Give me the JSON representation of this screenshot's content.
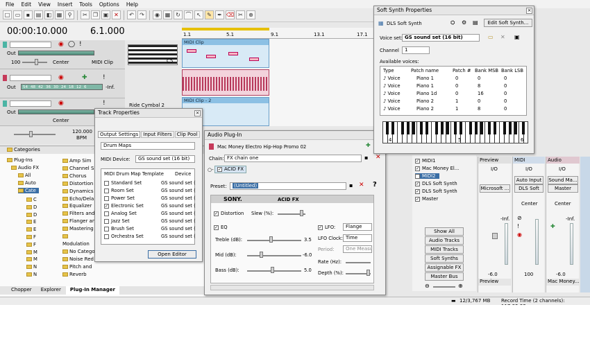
{
  "menu": [
    "File",
    "Edit",
    "View",
    "Insert",
    "Tools",
    "Options",
    "Help"
  ],
  "transport": {
    "time": "00:00:10.000",
    "measure": "6.1.000",
    "tempo": "120.000",
    "tempo_label": "BPM"
  },
  "ruler_marks": [
    "1.1",
    "5.1",
    "9.1",
    "13.1",
    "17.1",
    "21.1"
  ],
  "tracks": [
    {
      "out": "Out",
      "vol": "100",
      "pan": "Center",
      "clip": "MIDI Clip",
      "note_label": "C5"
    },
    {
      "out": "Out",
      "pan": "Center",
      "clip": "-Inf.",
      "meter": [
        "54",
        "48",
        "42",
        "36",
        "30",
        "24",
        "18",
        "12",
        "6"
      ]
    },
    {
      "out": "Out",
      "pan": "Center",
      "clip": "MIDI Clip",
      "label": "Ride Cymbal 2"
    }
  ],
  "clips": {
    "midi1": "MIDI Clip",
    "midi2": "MIDI Clip - 2"
  },
  "plugin_browser": {
    "categories_label": "Categories",
    "tree": [
      "Plug-Ins",
      "Audio FX",
      "All",
      "Auto",
      "Cate"
    ],
    "items": [
      "Amp Sim",
      "Channel S",
      "Chorus",
      "Distortion",
      "Dynamics",
      "Echo/Dela",
      "Equalizer",
      "Filters and",
      "Flanger an",
      "Mastering",
      "Modulation",
      "No Catego",
      "Noise Red",
      "Pitch and",
      "Reverb"
    ],
    "tabs": [
      "Chopper",
      "Explorer",
      "Plug-In Manager"
    ]
  },
  "track_properties": {
    "title": "Track Properties",
    "tabs": [
      "Output Settings",
      "Input Filters",
      "Clip Pool"
    ],
    "drum_maps": "Drum Maps",
    "midi_device_label": "MIDI Device:",
    "midi_device": "GS sound set (16 bit)",
    "col_template": "MIDI Drum Map Template",
    "col_device": "Device",
    "rows": [
      {
        "name": "Standard Set",
        "device": "GS sound set (",
        "checked": false
      },
      {
        "name": "Room Set",
        "device": "GS sound set (",
        "checked": false
      },
      {
        "name": "Power Set",
        "device": "GS sound set (",
        "checked": false
      },
      {
        "name": "Electronic Set",
        "device": "GS sound set (",
        "checked": true
      },
      {
        "name": "Analog Set",
        "device": "GS sound set (",
        "checked": false
      },
      {
        "name": "Jazz Set",
        "device": "GS sound set (",
        "checked": false
      },
      {
        "name": "Brush Set",
        "device": "GS sound set (",
        "checked": false
      },
      {
        "name": "Orchestra Set",
        "device": "GS sound set (",
        "checked": false
      }
    ],
    "open_editor": "Open Editor"
  },
  "audio_plugin": {
    "title": "Audio Plug-In",
    "track_name": "Mac Money Electro Hip-Hop Promo 02",
    "chain_label": "Chain:",
    "chain_value": "FX chain one",
    "fx_tab": "ACID FX",
    "preset_label": "Preset:",
    "preset_value": "(Untitled)",
    "brand": "SONY.",
    "product": "ACID FX",
    "distortion_label": "Distortion",
    "slew_label": "Slew (%):",
    "eq_label": "EQ",
    "treble_label": "Treble (dB):",
    "treble_value": "3.5",
    "mid_label": "Mid (dB):",
    "mid_value": "-6.0",
    "bass_label": "Bass (dB):",
    "bass_value": "5.0",
    "lfo_label": "LFO:",
    "lfo_value": "Flange",
    "lfo_clock_label": "LFO Clock:",
    "lfo_clock_value": "Time",
    "period_label": "Period:",
    "period_value": "One Measure",
    "rate_label": "Rate (Hz):",
    "depth_label": "Depth (%):"
  },
  "soft_synth": {
    "title": "Soft Synth Properties",
    "synth_name": "DLS Soft Synth",
    "edit_label": "Edit Soft Synth...",
    "voice_set_label": "Voice set:",
    "voice_set": "GS sound set (16 bit)",
    "channel_label": "Channel",
    "channel": "1",
    "available_label": "Available voices:",
    "columns": [
      "Type",
      "Patch name",
      "Patch #",
      "Bank MSB",
      "Bank LSB"
    ],
    "voices": [
      {
        "type": "Voice",
        "name": "Piano 1",
        "patch": "0",
        "msb": "0",
        "lsb": "0"
      },
      {
        "type": "Voice",
        "name": "Piano 1",
        "patch": "0",
        "msb": "8",
        "lsb": "0"
      },
      {
        "type": "Voice",
        "name": "Piano 1d",
        "patch": "0",
        "msb": "16",
        "lsb": "0"
      },
      {
        "type": "Voice",
        "name": "Piano 2",
        "patch": "1",
        "msb": "0",
        "lsb": "0"
      },
      {
        "type": "Voice",
        "name": "Piano 2",
        "patch": "1",
        "msb": "8",
        "lsb": "0"
      }
    ],
    "octaves": [
      "4",
      "5",
      "6"
    ]
  },
  "routing": {
    "items": [
      "MIDI1",
      "Mac Money El...",
      "MIDI2",
      "DLS Soft Synth",
      "DLS Soft Synth",
      "Master"
    ],
    "buttons": [
      "Show All",
      "Audio Tracks",
      "MIDI Tracks",
      "Soft Synths",
      "Assignable FX",
      "Master Bus"
    ]
  },
  "mixer": {
    "strips": [
      {
        "name": "Preview",
        "io": "I/O",
        "input": "Microsoft ...",
        "pan": "",
        "level": "-Inf.",
        "foot": "-6.0"
      },
      {
        "name": "MIDI",
        "io": "I/O",
        "input": "Auto Input",
        "out": "DLS Soft S...",
        "pan": "Center",
        "level": "",
        "foot": "100"
      },
      {
        "name": "Audio",
        "io": "I/O",
        "input": "Sound Ma...",
        "out": "Master",
        "pan": "Center",
        "level": "-Inf.",
        "foot": "-6.0"
      }
    ],
    "bottom": [
      "Preview",
      "Mac Money..."
    ]
  },
  "status": {
    "disk": "12/3,767 MB",
    "record": "Record Time (2 channels): 117:25:55"
  }
}
